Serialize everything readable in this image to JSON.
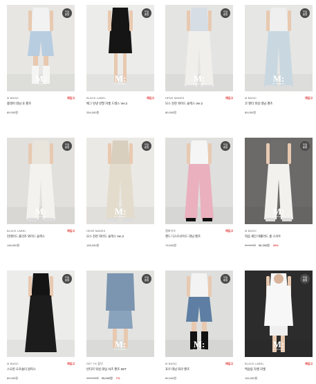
{
  "badge_text": [
    "오늘",
    "출발"
  ],
  "watermark": {
    "mark": "M:",
    "sub": "MY MOMENT"
  },
  "colors": {
    "accent": "#e0302f",
    "badge_bg": "#4a4a4a"
  },
  "products": [
    {
      "brand": "M BASIC",
      "tag": "재입고",
      "title": "롱데어 데님 숏 팬츠",
      "price": "89,000원",
      "badge": true,
      "watermark": true,
      "top": "#f2f2f2",
      "bottom": "#b8cde0",
      "boots": true,
      "bg": "#e7e6e3"
    },
    {
      "brand": "BLACK LABEL",
      "tag": "재입고",
      "title": "베그 린넨 반팔 자켓 드레스 Ver.2",
      "price": "254,000원",
      "badge": true,
      "watermark": true,
      "top": "#151515",
      "bottom": "#151515",
      "boots": false,
      "bg": "#ececea"
    },
    {
      "brand": "HENS MADES",
      "tag": "재입고",
      "title": "모스 잔잔 와이드 슬랙스 Ver.2",
      "price": "89,000원",
      "badge": true,
      "watermark": true,
      "top": "#d7dde4",
      "bottom": "#f0efec",
      "boots": false,
      "bg": "#e4e4e2"
    },
    {
      "brand": "M BASIC",
      "tag": "재입고",
      "title": "코 앤터 워싱 데님 팬츠",
      "price": "89,000원",
      "badge": true,
      "watermark": true,
      "top": "#efefef",
      "bottom": "#c9d8e0",
      "boots": false,
      "bg": "#e6e6e4"
    },
    {
      "brand": "BLACK LABEL",
      "tag": "재입고",
      "title": "언데이드 플리츠 와이드 슬랙스",
      "price": "148,000원",
      "badge": true,
      "watermark": true,
      "top": "#e9e4dc",
      "bottom": "#f3f2ee",
      "boots": false,
      "bg": "#e1e0dd"
    },
    {
      "brand": "HENS MADES",
      "tag": "",
      "title": "모스 잔잔 와이드 슬랙스 Ver.2",
      "price": "158,000원",
      "badge": true,
      "watermark": true,
      "top": "#d8cfbf",
      "bottom": "#e3dccd",
      "boots": false,
      "bg": "#ebe9e5"
    },
    {
      "brand": "캠퍼키즈",
      "tag": "재입고",
      "title": "핸드 디스트로이드 데님 팬츠",
      "price": "79,000원",
      "badge": true,
      "watermark": false,
      "top": "#f5f5f5",
      "bottom": "#eab0be",
      "boots": true,
      "bg": "#dfdfdd"
    },
    {
      "brand": "M BASIC",
      "tag": "",
      "title": "뭐끔 세인 바롤어드 롱 스커트",
      "price_old": "69,000원",
      "price_sale": "55,300원",
      "pct": "20%",
      "badge": true,
      "watermark": true,
      "top": "#6f6e6c",
      "bottom": "#f2f1ee",
      "boots": false,
      "bg": "#6b6a68"
    },
    {
      "brand": "M BASIC",
      "tag": "재입고",
      "title": "스모킹 오프숄더 원피스",
      "price": "89,000원",
      "badge": true,
      "watermark": false,
      "top": "#141414",
      "bottom": "#1c1c1c",
      "boots": false,
      "bg": "#ececea"
    },
    {
      "brand": "SET 7% 할인",
      "tag": "",
      "title": "빈티지 워싱 데님 셔츠 팬츠 SET",
      "price_old": "119,000원",
      "price_sale": "95,000원",
      "pct": "7%",
      "badge": true,
      "watermark": true,
      "top": "#7b95b0",
      "bottom": "#8aa3bd",
      "boots": false,
      "bg": "#e3e3e1"
    },
    {
      "brand": "M BASIC",
      "tag": "재입고",
      "title": "포르 데님 와코 팬츠",
      "price": "89,000원",
      "badge": true,
      "watermark": true,
      "top": "#f3f3f3",
      "bottom": "#5e7fa3",
      "boots": true,
      "bg": "#dededc"
    },
    {
      "brand": "BLACK LABEL",
      "tag": "재입고",
      "title": "백숨링 자켓 자켓",
      "price": "154,000원",
      "badge": true,
      "watermark": true,
      "top": "#f7f7f7",
      "bottom": "#efefef",
      "boots": false,
      "bg": "#2c2c2c"
    }
  ]
}
